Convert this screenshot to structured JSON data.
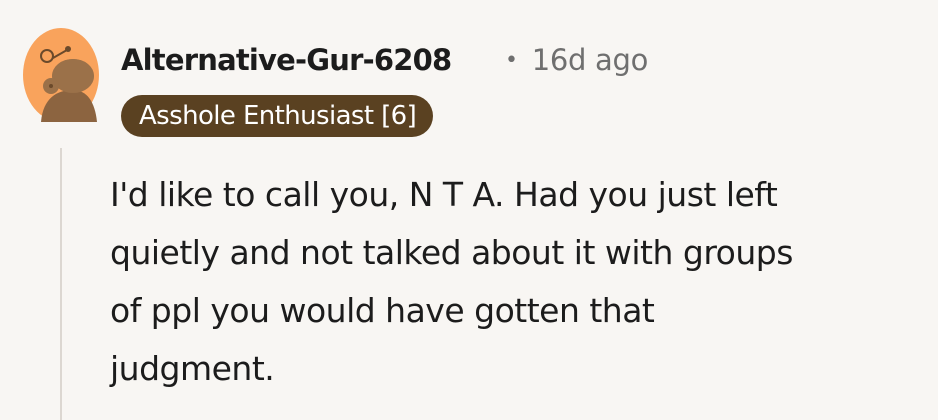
{
  "comment": {
    "author": "Alternative-Gur-6208",
    "separator": "•",
    "timestamp": "16d ago",
    "flair": "Asshole Enthusiast [6]",
    "avatar_icon": "snoo-avatar-icon",
    "body_lines": [
      "I'd like to call you, N T A. Had you just left",
      "quietly and not talked about it with groups",
      "of ppl you would have gotten that",
      "judgment."
    ]
  },
  "colors": {
    "background": "#f8f6f3",
    "avatar_bg": "#f9a35c",
    "flair_bg": "#5a4121",
    "text": "#1c1c1c",
    "meta": "#6f6f6f"
  }
}
